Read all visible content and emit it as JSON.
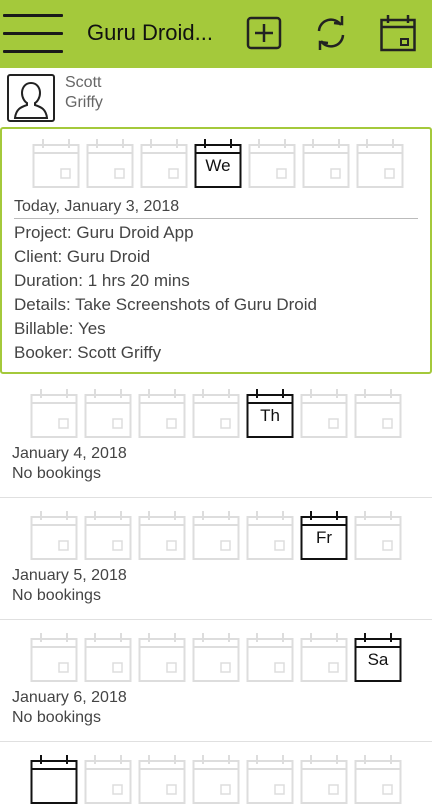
{
  "appbar": {
    "title": "Guru Droid...",
    "icons": [
      "menu-icon",
      "add-icon",
      "refresh-icon",
      "calendar-icon"
    ],
    "color": "#a4c93b"
  },
  "user": {
    "first": "Scott",
    "last": "Griffy",
    "icon": "user-silhouette-icon"
  },
  "days": [
    {
      "weekday": "We",
      "date": "Today, January 3, 2018",
      "selected": true,
      "details": {
        "project": "Project: Guru Droid App",
        "client": "Client: Guru Droid",
        "duration": "Duration: 1 hrs 20 mins",
        "details": "Details: Take Screenshots of Guru Droid",
        "billable": "Billable: Yes",
        "booker": "Booker: Scott Griffy"
      }
    },
    {
      "weekday": "Th",
      "date": "January 4, 2018",
      "status": "No bookings"
    },
    {
      "weekday": "Fr",
      "date": "January 5, 2018",
      "status": "No bookings"
    },
    {
      "weekday": "Sa",
      "date": "January 6, 2018",
      "status": "No bookings"
    }
  ]
}
